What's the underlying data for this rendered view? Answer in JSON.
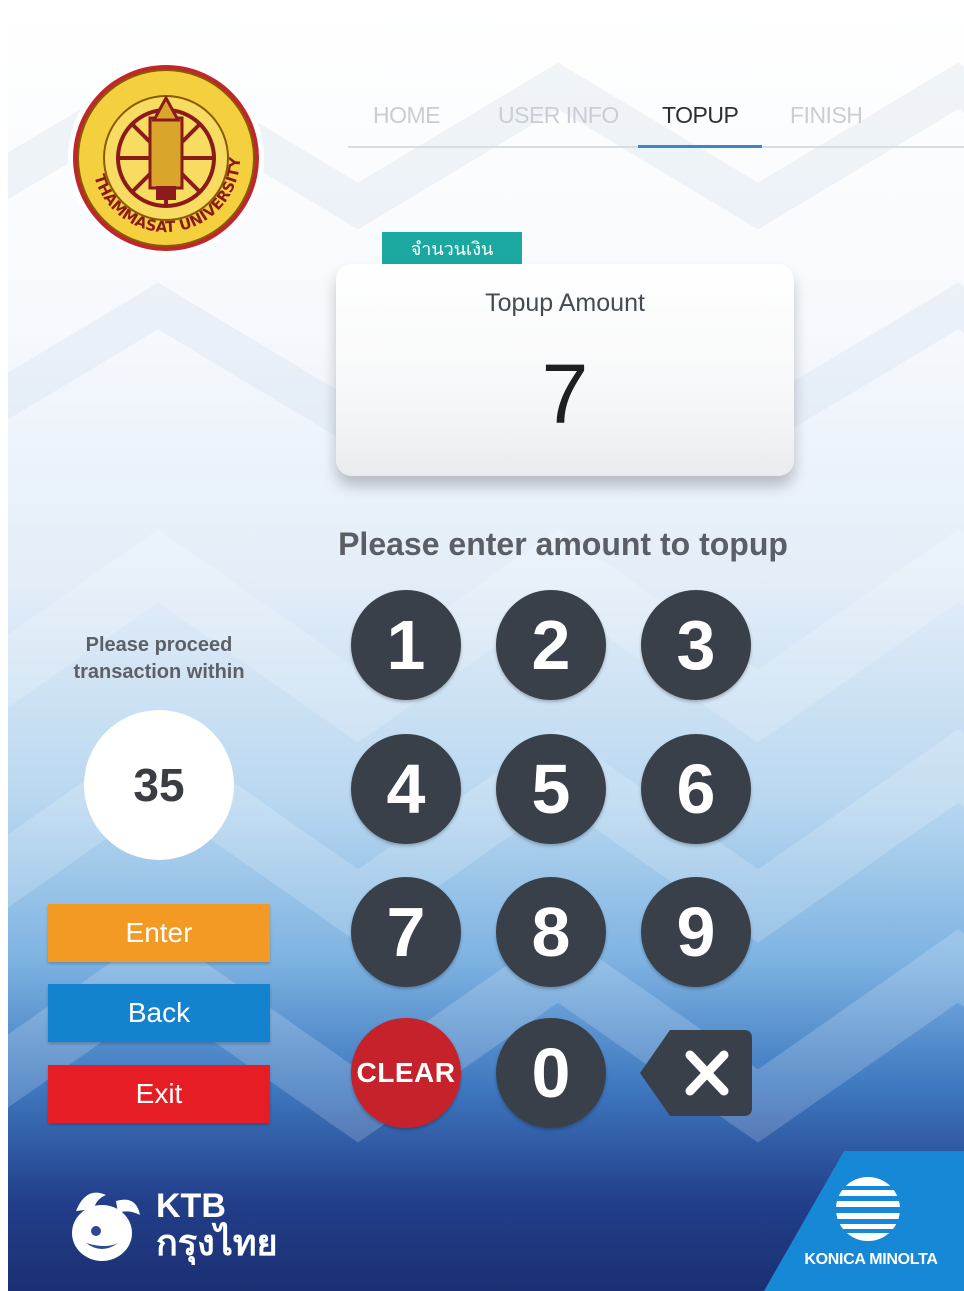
{
  "nav": {
    "items": [
      {
        "label": "HOME",
        "active": false
      },
      {
        "label": "USER INFO",
        "active": false
      },
      {
        "label": "TOPUP",
        "active": true
      },
      {
        "label": "FINISH",
        "active": false
      }
    ]
  },
  "logo": {
    "university_text": "THAMMASAT UNIVERSITY"
  },
  "amount": {
    "tag": "จำนวนเงิน",
    "label": "Topup Amount",
    "value": "7"
  },
  "instruction": "Please enter amount to topup",
  "keypad": {
    "keys": [
      "1",
      "2",
      "3",
      "4",
      "5",
      "6",
      "7",
      "8",
      "9"
    ],
    "clear": "CLEAR",
    "zero": "0",
    "backspace_icon": "backspace-icon"
  },
  "side": {
    "proceed_line1": "Please proceed",
    "proceed_line2": "transaction within",
    "timer": "35",
    "enter": "Enter",
    "back": "Back",
    "exit": "Exit"
  },
  "footer": {
    "bank_name": "KTB",
    "bank_thai": "กรุงไทย",
    "brand": "KONICA MINOLTA"
  },
  "colors": {
    "enter": "#f39a25",
    "back": "#1483cf",
    "exit": "#e71d25",
    "key": "#3a4049",
    "clear": "#c5222b",
    "tag": "#1ba8a1",
    "nav_active_underline": "#3a86c8"
  }
}
